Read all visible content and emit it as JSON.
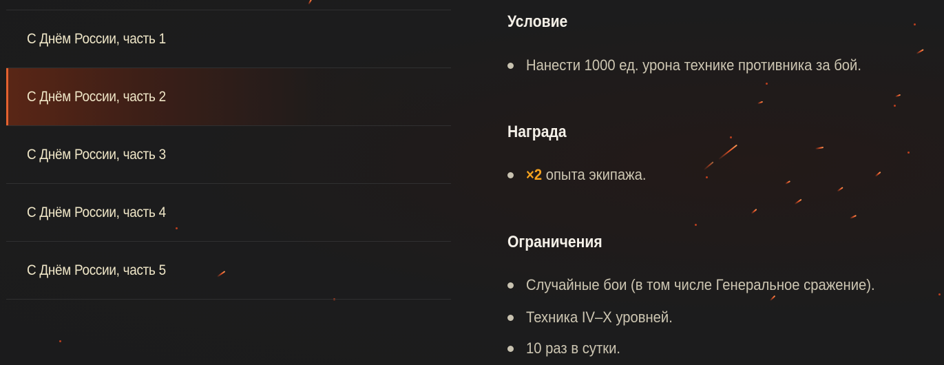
{
  "quest_list": {
    "items": [
      {
        "label": "С Днём России, часть 1"
      },
      {
        "label": "С Днём России, часть 2",
        "active": true
      },
      {
        "label": "С Днём России, часть 3"
      },
      {
        "label": "С Днём России, часть 4"
      },
      {
        "label": "С Днём России, часть 5"
      }
    ]
  },
  "details": {
    "condition": {
      "title": "Условие",
      "items": [
        "Нанести 1000 ед. урона технике противника за бой."
      ]
    },
    "reward": {
      "title": "Награда",
      "multiplier": "×2",
      "text": " опыта экипажа."
    },
    "restrictions": {
      "title": "Ограничения",
      "items": [
        "Случайные бои (в том числе Генеральное сражение).",
        "Техника IV–X уровней.",
        "10 раз в сутки."
      ]
    }
  },
  "colors": {
    "background": "#1c1c1d",
    "accent": "#e4622f",
    "highlight": "#f4a21f",
    "title_text": "#f4f0e8",
    "body_text": "#cdc6b2"
  }
}
